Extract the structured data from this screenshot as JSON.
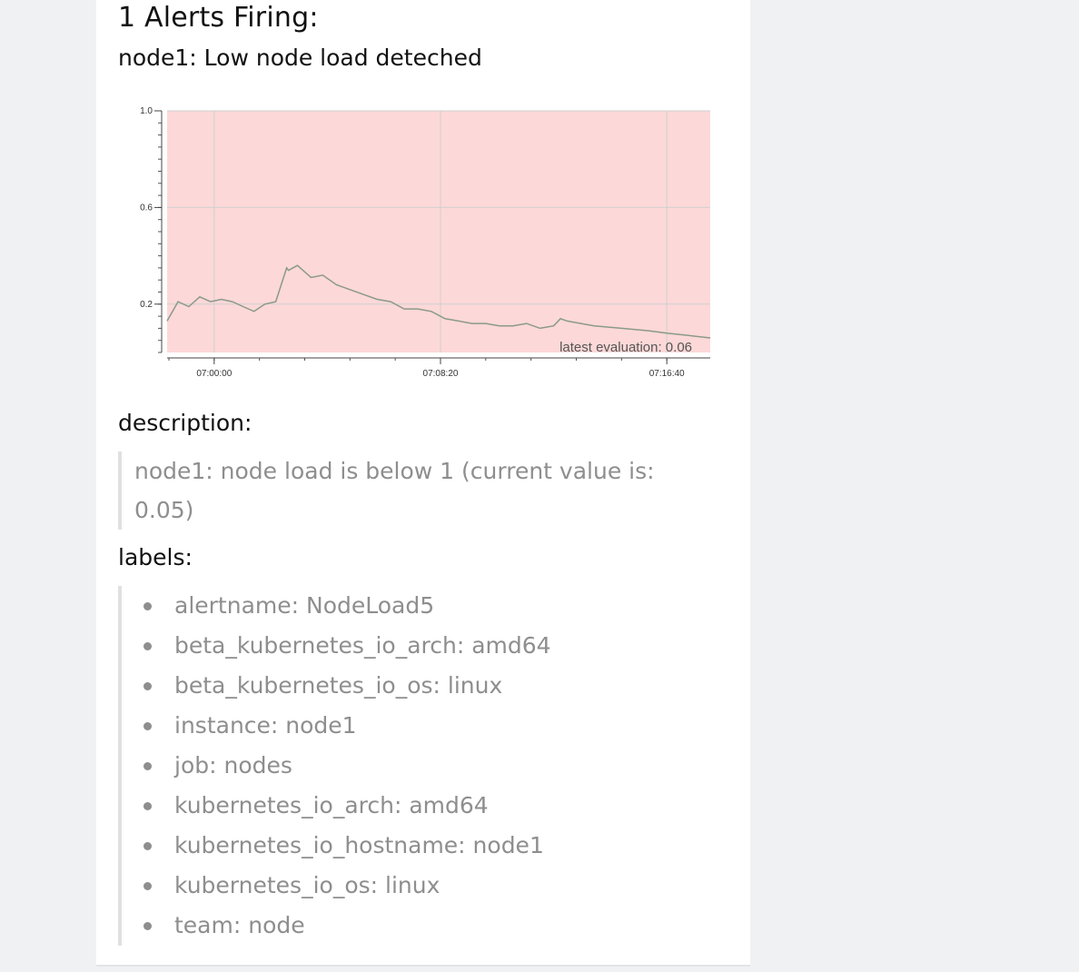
{
  "alert": {
    "title": "1 Alerts Firing:",
    "summary": "node1: Low node load deteched"
  },
  "description": {
    "heading": "description:",
    "text": "node1: node load is below 1 (current value is: 0.05)"
  },
  "labels": {
    "heading": "labels:",
    "items": [
      "alertname: NodeLoad5",
      "beta_kubernetes_io_arch: amd64",
      "beta_kubernetes_io_os: linux",
      "instance: node1",
      "job: nodes",
      "kubernetes_io_arch: amd64",
      "kubernetes_io_hostname: node1",
      "kubernetes_io_os: linux",
      "team: node"
    ]
  },
  "colors": {
    "alert_band": "#fdd8d8",
    "series_line": "#8a9a8a",
    "grid": "#d0d0d0",
    "page_bg": "#f0f1f3"
  },
  "chart_data": {
    "type": "line",
    "title": "",
    "xlabel": "",
    "ylabel": "",
    "ylim": [
      0,
      1.0
    ],
    "y_ticks": [
      "1.0",
      "0.6",
      "0.2"
    ],
    "x_ticks": [
      "07:00:00",
      "07:08:20",
      "07:16:40"
    ],
    "annotation": "latest evaluation: 0.06",
    "alert_region": true,
    "grid": true,
    "series": [
      {
        "x": [
          "06:58:16",
          "06:58:40",
          "06:59:04",
          "06:59:28",
          "06:59:52",
          "07:00:16",
          "07:00:40",
          "07:01:04",
          "07:01:28",
          "07:01:52",
          "07:02:16",
          "07:02:40",
          "07:02:44",
          "07:03:04",
          "07:03:16",
          "07:03:34",
          "07:04:00",
          "07:04:30",
          "07:05:00",
          "07:05:30",
          "07:06:00",
          "07:06:30",
          "07:07:00",
          "07:07:30",
          "07:08:00",
          "07:08:30",
          "07:09:00",
          "07:09:30",
          "07:10:00",
          "07:10:30",
          "07:11:00",
          "07:11:30",
          "07:12:00",
          "07:12:30",
          "07:12:45",
          "07:13:00",
          "07:13:30",
          "07:14:00",
          "07:15:00",
          "07:16:00",
          "07:16:40",
          "07:17:30",
          "07:18:16"
        ],
        "values": [
          0.13,
          0.21,
          0.19,
          0.23,
          0.21,
          0.22,
          0.21,
          0.19,
          0.17,
          0.2,
          0.21,
          0.35,
          0.34,
          0.36,
          0.34,
          0.31,
          0.32,
          0.28,
          0.26,
          0.24,
          0.22,
          0.21,
          0.18,
          0.18,
          0.17,
          0.14,
          0.13,
          0.12,
          0.12,
          0.11,
          0.11,
          0.12,
          0.1,
          0.11,
          0.14,
          0.13,
          0.12,
          0.11,
          0.1,
          0.09,
          0.08,
          0.07,
          0.06
        ]
      }
    ]
  }
}
